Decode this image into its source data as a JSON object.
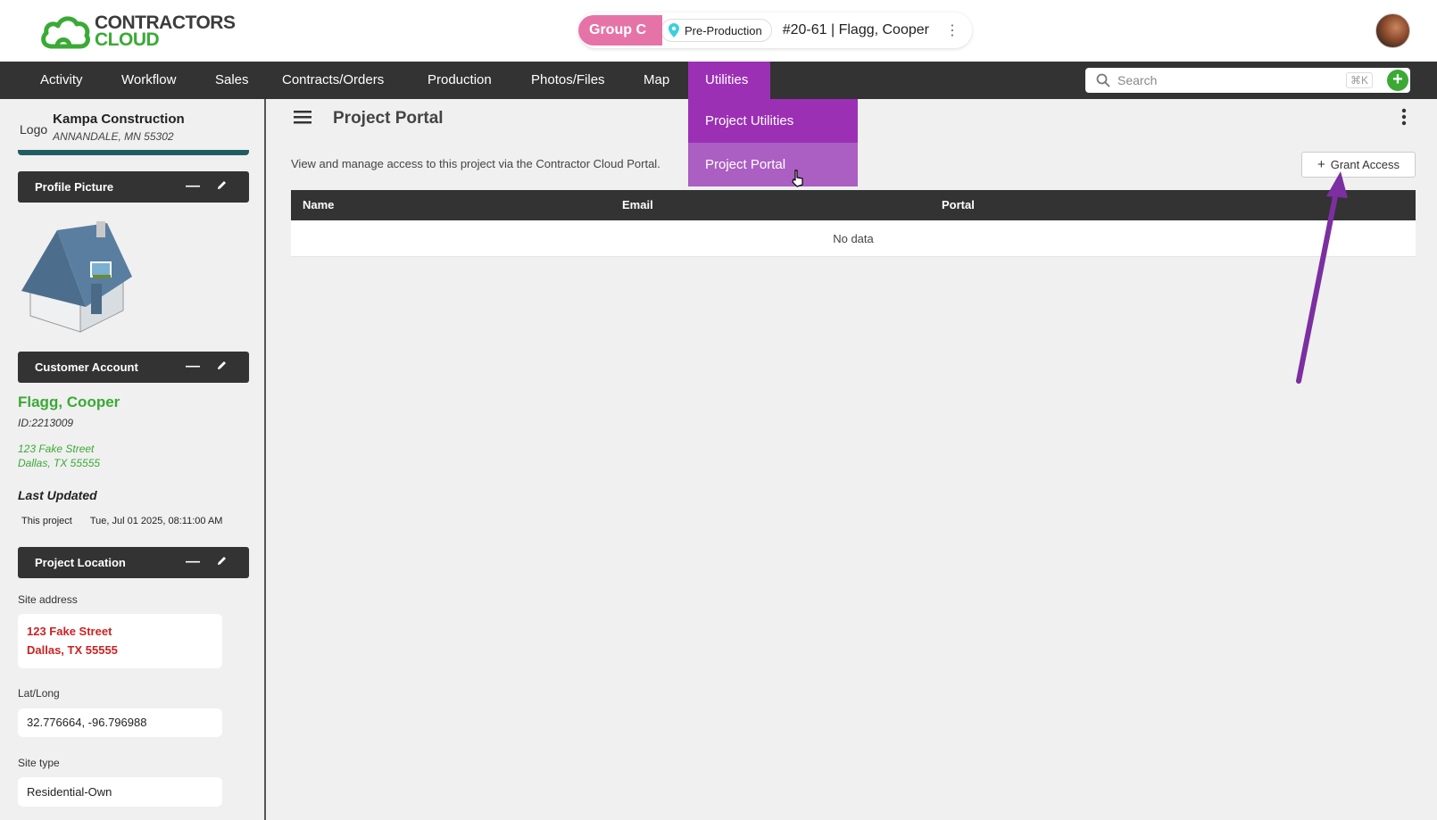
{
  "header": {
    "logo_line1": "CONTRACTORS",
    "logo_line2": "CLOUD",
    "group_tag": "Group C",
    "stage": "Pre-Production",
    "project_title": "#20-61 | Flagg, Cooper",
    "kebab": "⋮"
  },
  "nav": {
    "items": [
      "Activity",
      "Workflow",
      "Sales",
      "Contracts/Orders",
      "Production",
      "Photos/Files",
      "Map",
      "Utilities"
    ],
    "active": "Utilities",
    "search_placeholder": "Search",
    "shortcut": "⌘K",
    "add": "+"
  },
  "dropdown": {
    "items": [
      "Project Utilities",
      "Project Portal"
    ]
  },
  "sidebar": {
    "logo_alt": "Logo",
    "company_name": "Kampa Construction",
    "company_address": "ANNANDALE, MN 55302",
    "panels": {
      "profile": "Profile Picture",
      "customer": "Customer Account",
      "location": "Project Location"
    },
    "customer": {
      "name": "Flagg, Cooper",
      "id": "ID:2213009",
      "address_line1": "123 Fake Street",
      "address_line2": "Dallas, TX 55555"
    },
    "last_updated": {
      "label": "Last Updated",
      "scope": "This project",
      "value": "Tue, Jul 01 2025, 08:11:00 AM"
    },
    "location": {
      "site_address_label": "Site address",
      "site_address_line1": "123 Fake Street",
      "site_address_line2": "Dallas, TX 55555",
      "latlong_label": "Lat/Long",
      "latlong": "32.776664, -96.796988",
      "site_type_label": "Site type",
      "site_type": "Residential-Own"
    }
  },
  "main": {
    "title": "Project Portal",
    "description": "View and manage access to this project via the Contractor Cloud Portal.",
    "grant_label": "Grant Access",
    "table": {
      "columns": [
        "Name",
        "Email",
        "Portal"
      ],
      "empty": "No data"
    }
  },
  "colors": {
    "brand_green": "#3aaa35",
    "nav_dark": "#333333",
    "accent_purple": "#9b30b5",
    "group_pink": "#e573a8"
  }
}
